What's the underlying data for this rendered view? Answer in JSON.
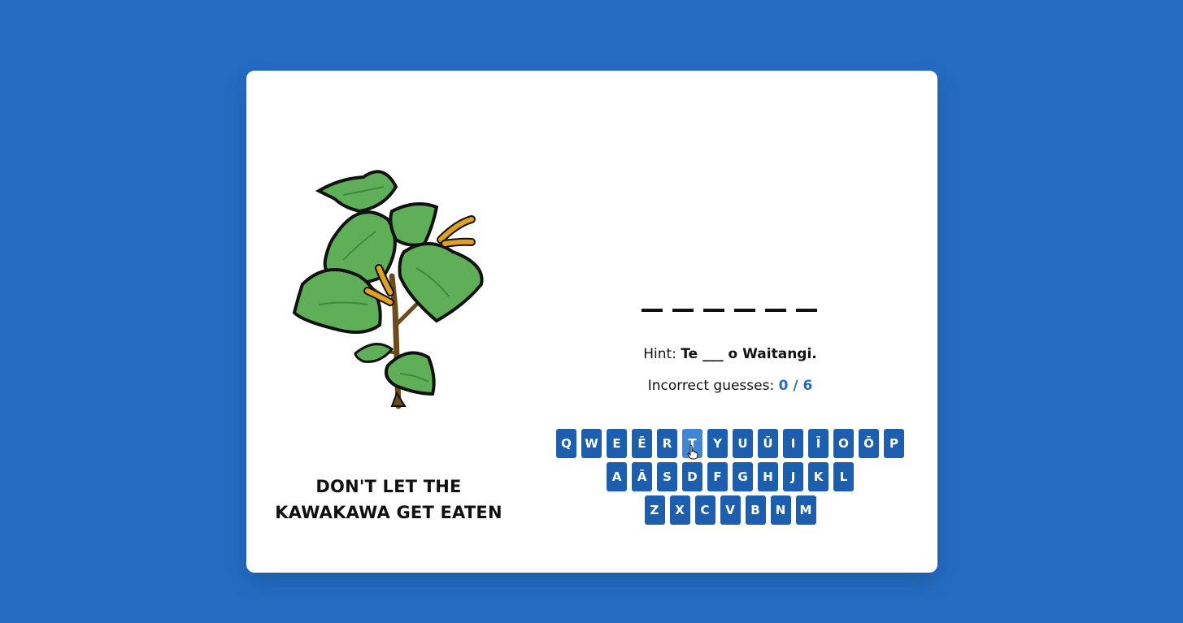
{
  "game": {
    "title_line1": "DON'T LET THE",
    "title_line2": "KAWAKAWA GET EATEN",
    "blank_count": 6,
    "hint_label": "Hint:",
    "hint_text": "Te ___ o Waitangi.",
    "incorrect_label": "Incorrect guesses:",
    "incorrect_count": "0 / 6"
  },
  "keyboard": {
    "row1": [
      "Q",
      "W",
      "E",
      "Ē",
      "R",
      "T",
      "Y",
      "U",
      "Ū",
      "I",
      "Ī",
      "O",
      "Ō",
      "P"
    ],
    "row2": [
      "A",
      "Ā",
      "S",
      "D",
      "F",
      "G",
      "H",
      "J",
      "K",
      "L"
    ],
    "row3": [
      "Z",
      "X",
      "C",
      "V",
      "B",
      "N",
      "M"
    ],
    "hovered_key": "T"
  },
  "icons": {
    "illustration": "kawakawa-plant-icon",
    "cursor": "hand-pointer-icon"
  },
  "colors": {
    "background": "#256cc2",
    "key": "#1d5fae",
    "key_hover": "#3f86d6",
    "count_accent": "#256cc2"
  }
}
